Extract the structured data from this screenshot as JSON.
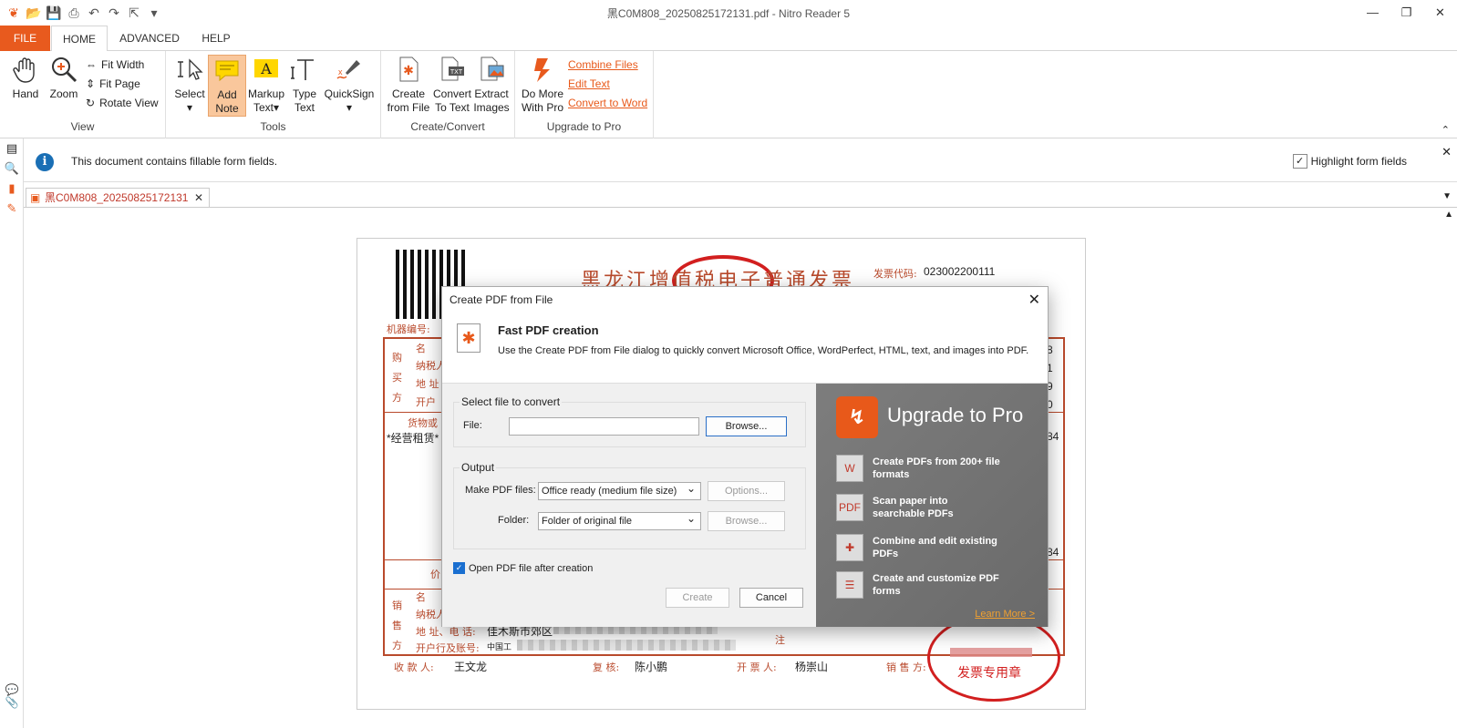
{
  "window": {
    "title": "黑C0M808_20250825172131.pdf - Nitro Reader 5"
  },
  "tabs": [
    {
      "label": "FILE"
    },
    {
      "label": "HOME"
    },
    {
      "label": "ADVANCED"
    },
    {
      "label": "HELP"
    }
  ],
  "ribbon": {
    "view": {
      "hand": "Hand",
      "zoom": "Zoom",
      "fit_width": "Fit Width",
      "fit_page": "Fit Page",
      "rotate": "Rotate View",
      "label": "View"
    },
    "tools": {
      "select": "Select",
      "add_note_1": "Add",
      "add_note_2": "Note",
      "markup_1": "Markup",
      "markup_2": "Text",
      "type_1": "Type",
      "type_2": "Text",
      "quicksign": "QuickSign",
      "label": "Tools"
    },
    "create": {
      "create_1": "Create",
      "create_2": "from File",
      "convert_1": "Convert",
      "convert_2": "To Text",
      "extract_1": "Extract",
      "extract_2": "Images",
      "label": "Create/Convert"
    },
    "pro": {
      "domore_1": "Do More",
      "domore_2": "With Pro",
      "combine": "Combine Files",
      "edit": "Edit Text",
      "convert_word": "Convert to Word",
      "label": "Upgrade to Pro"
    }
  },
  "infobar": {
    "message": "This document contains fillable form fields.",
    "highlight": "Highlight form fields"
  },
  "doc_tab": {
    "name": "黑C0M808_20250825172131"
  },
  "invoice": {
    "title": "黑龙江增值税电子普通发票",
    "code_label": "发票代码:",
    "code_value": "023002200111",
    "machine_label": "机器编号:",
    "buyer": [
      "购",
      "买",
      "方"
    ],
    "seller": [
      "销",
      "售",
      "方"
    ],
    "goods_label": "货物或",
    "goods_item": "*经营租赁*",
    "addr_label": "地 址、电 话:",
    "addr_value": "佳木斯市郊区",
    "bank_label": "开户行及账号:",
    "bank_value": "中国工",
    "payee_label": "收 款 人:",
    "payee": "王文龙",
    "reviewer_label": "复 核:",
    "reviewer": "陈小鹏",
    "drawer_label": "开 票 人:",
    "drawer": "杨崇山",
    "seller_label": "销 售 方:",
    "stamp_text": "发票专用章",
    "note_label": "注",
    "digits": [
      "8",
      "1",
      "9",
      "0"
    ],
    "amount_1": "84",
    "amount_2": "84",
    "price_label": "价",
    "name_label": "名",
    "tax_label": "纳税人"
  },
  "dialog": {
    "title": "Create PDF from File",
    "heading": "Fast PDF creation",
    "desc": "Use the Create PDF from File dialog to quickly convert Microsoft Office, WordPerfect, HTML, text, and images into PDF.",
    "select_legend": "Select file to convert",
    "file_label": "File:",
    "browse": "Browse...",
    "output_legend": "Output",
    "make_label": "Make PDF files:",
    "make_value": "Office ready (medium file size)",
    "options": "Options...",
    "folder_label": "Folder:",
    "folder_value": "Folder of original file",
    "browse2": "Browse...",
    "open_after": "Open PDF file after creation",
    "create": "Create",
    "cancel": "Cancel",
    "promo": {
      "header": "Upgrade to Pro",
      "items": [
        "Create PDFs from 200+ file formats",
        "Scan paper into searchable PDFs",
        "Combine and edit existing PDFs",
        "Create and customize PDF forms"
      ],
      "learn": "Learn More >"
    }
  },
  "colors": {
    "accent": "#e85a1e",
    "invoice_red": "#b94a2c",
    "stamp": "#d21f1f"
  }
}
